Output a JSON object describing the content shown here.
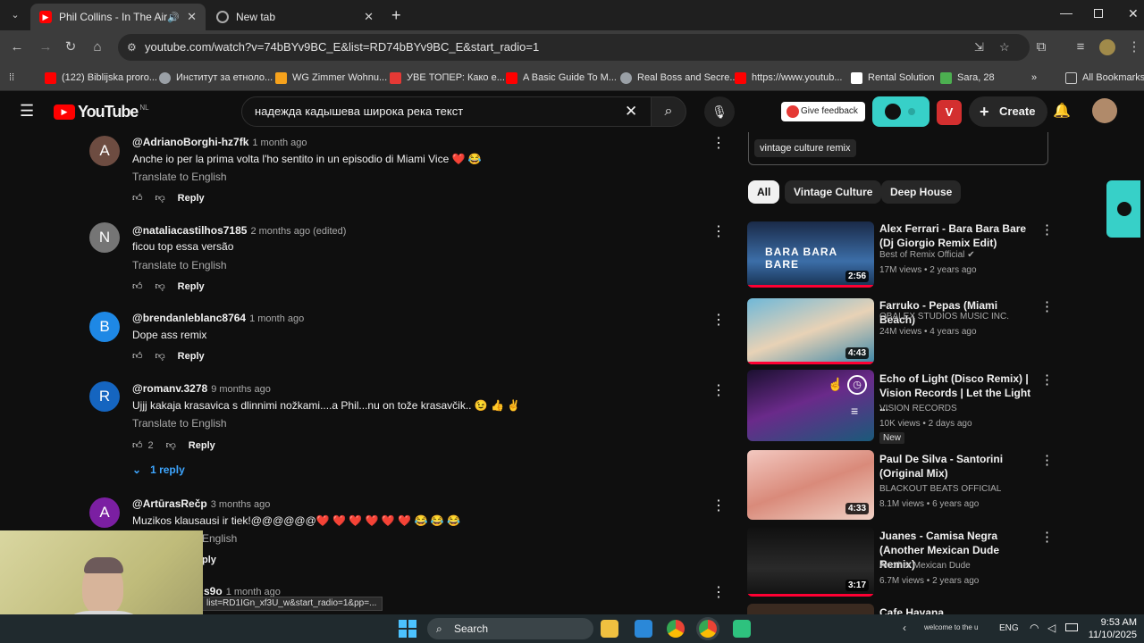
{
  "browser": {
    "tabs": [
      {
        "title": "Phil Collins - In The Air Toni",
        "active": true
      },
      {
        "title": "New tab",
        "active": false
      }
    ],
    "url": "youtube.com/watch?v=74bBYv9BC_E&list=RD74bBYv9BC_E&start_radio=1",
    "bookmarks": [
      {
        "label": "(122) Biblijska proro...",
        "color": "#ff0000"
      },
      {
        "label": "Институт за етноло...",
        "color": "#9aa0a6"
      },
      {
        "label": "WG Zimmer Wohnu...",
        "color": "#f6a21c"
      },
      {
        "label": "УВЕ ТОПЕР: Како е...",
        "color": "#e53935"
      },
      {
        "label": "A Basic Guide To M...",
        "color": "#ff0000"
      },
      {
        "label": "Real Boss and Secre...",
        "color": "#9aa0a6"
      },
      {
        "label": "https://www.youtub...",
        "color": "#ff0000"
      },
      {
        "label": "Rental Solution",
        "color": "#ffffff"
      },
      {
        "label": "Sara, 28",
        "color": "#4caf50"
      }
    ],
    "all_bookmarks": "All Bookmarks",
    "status_link": "list=RD1IGn_xf3U_w&start_radio=1&pp=..."
  },
  "youtube": {
    "logo": "YouTube",
    "region": "NL",
    "search_query": "надежда кадышева широка река текст",
    "feedback": "Give feedback",
    "create": "Create",
    "comments": [
      {
        "avatar": "A",
        "color": "#6d4c41",
        "handle": "@AdrianoBorghi-hz7fk",
        "time": "1 month ago",
        "text": "Anche io per la prima volta l'ho sentito in un episodio di Miami Vice ❤️ 😂",
        "translate": "Translate to English",
        "likes": "",
        "reply": "Reply"
      },
      {
        "avatar": "N",
        "color": "#757575",
        "handle": "@nataliacastilhos7185",
        "time": "2 months ago (edited)",
        "text": "ficou top essa versão",
        "translate": "Translate to English",
        "likes": "",
        "reply": "Reply"
      },
      {
        "avatar": "B",
        "color": "#1e88e5",
        "handle": "@brendanleblanc8764",
        "time": "1 month ago",
        "text": "Dope ass remix",
        "translate": "",
        "likes": "",
        "reply": "Reply"
      },
      {
        "avatar": "R",
        "color": "#1565c0",
        "handle": "@romanv.3278",
        "time": "9 months ago",
        "text": "Ujjj kakaja krasavica s dlinnimi nožkami....a Phil...nu on tože krasavčik.. 😉 👍 ✌️",
        "translate": "Translate to English",
        "likes": "2",
        "reply": "Reply"
      },
      {
        "avatar": "A",
        "color": "#7b1fa2",
        "handle": "@ArtūrasRečp",
        "time": "3 months ago",
        "text": "Muzikos klausausi ir tiek!@@@@@@❤️ ❤️ ❤️ ❤️ ❤️ ❤️ 😂 😂 😂",
        "translate": "English",
        "likes": "",
        "reply": "ply"
      }
    ],
    "replies_toggle": "1 reply",
    "partial_comment": {
      "handle": "s9o",
      "time": "1 month ago"
    },
    "search_chip": "vintage culture remix",
    "chips": [
      "All",
      "Vintage Culture",
      "Deep House"
    ],
    "videos": [
      {
        "title": "Alex Ferrari - Bara Bara Bare (Dj Giorgio Remix Edit)",
        "channel": "Best of Remix Official",
        "verified": true,
        "meta": "17M views • 2 years ago",
        "duration": "2:56",
        "thumb_text": "BARA BARA BARE",
        "badge": ""
      },
      {
        "title": "Farruko - Pepas (Miami Beach)",
        "channel": "OBALEX STUDIOS MUSIC INC.",
        "verified": false,
        "meta": "24M views • 4 years ago",
        "duration": "4:43",
        "thumb_text": "",
        "badge": ""
      },
      {
        "title": "Echo of Light (Disco Remix) | Vision Records | Let the Light ...",
        "channel": "VISION RECORDS",
        "verified": false,
        "meta": "10K views • 2 days ago",
        "duration": "",
        "thumb_text": "",
        "badge": "New"
      },
      {
        "title": "Paul De Silva - Santorini (Original Mix)",
        "channel": "BLACKOUT BEATS OFFICIAL",
        "verified": false,
        "meta": "8.1M views • 6 years ago",
        "duration": "4:33",
        "thumb_text": "",
        "badge": ""
      },
      {
        "title": "Juanes - Camisa Negra (Another Mexican Dude Remix)",
        "channel": "Another Mexican Dude",
        "verified": false,
        "meta": "6.7M views • 2 years ago",
        "duration": "3:17",
        "thumb_text": "",
        "badge": ""
      },
      {
        "title": "Cafe Havana ...",
        "channel": "",
        "verified": false,
        "meta": "",
        "duration": "",
        "thumb_text": "",
        "badge": ""
      }
    ]
  },
  "taskbar": {
    "search": "Search",
    "lang": "ENG",
    "time": "9:53 AM",
    "date": "11/10/2025",
    "tray_text": "welcome to the u"
  }
}
